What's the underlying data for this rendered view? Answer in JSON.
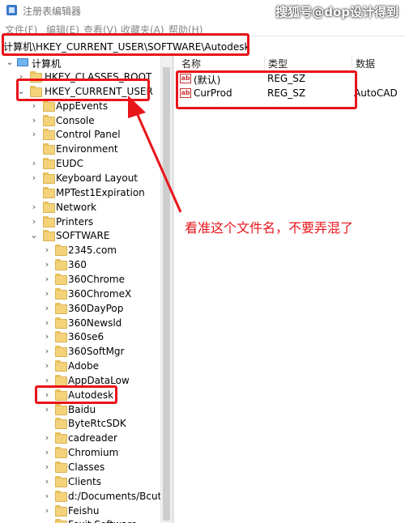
{
  "window": {
    "title": "注册表编辑器",
    "watermark": "搜狐号@dop设计得到"
  },
  "menu": [
    "文件(F)",
    "编辑(E)",
    "查看(V)",
    "收藏夹(A)",
    "帮助(H)"
  ],
  "address": "计算机\\HKEY_CURRENT_USER\\SOFTWARE\\Autodesk",
  "tree": {
    "root": "计算机",
    "items": [
      {
        "label": "HKEY_CLASSES_ROOT",
        "level": 1,
        "state": "collapsed"
      },
      {
        "label": "HKEY_CURRENT_USER",
        "level": 1,
        "state": "expanded"
      },
      {
        "label": "AppEvents",
        "level": 2,
        "state": "collapsed"
      },
      {
        "label": "Console",
        "level": 2,
        "state": "collapsed"
      },
      {
        "label": "Control Panel",
        "level": 2,
        "state": "collapsed"
      },
      {
        "label": "Environment",
        "level": 2,
        "state": "none"
      },
      {
        "label": "EUDC",
        "level": 2,
        "state": "collapsed"
      },
      {
        "label": "Keyboard Layout",
        "level": 2,
        "state": "collapsed"
      },
      {
        "label": "MPTest1Expiration",
        "level": 2,
        "state": "none"
      },
      {
        "label": "Network",
        "level": 2,
        "state": "collapsed"
      },
      {
        "label": "Printers",
        "level": 2,
        "state": "collapsed"
      },
      {
        "label": "SOFTWARE",
        "level": 2,
        "state": "expanded"
      },
      {
        "label": "2345.com",
        "level": 3,
        "state": "collapsed"
      },
      {
        "label": "360",
        "level": 3,
        "state": "collapsed"
      },
      {
        "label": "360Chrome",
        "level": 3,
        "state": "collapsed"
      },
      {
        "label": "360ChromeX",
        "level": 3,
        "state": "collapsed"
      },
      {
        "label": "360DayPop",
        "level": 3,
        "state": "collapsed"
      },
      {
        "label": "360Newsld",
        "level": 3,
        "state": "collapsed"
      },
      {
        "label": "360se6",
        "level": 3,
        "state": "collapsed"
      },
      {
        "label": "360SoftMgr",
        "level": 3,
        "state": "collapsed"
      },
      {
        "label": "Adobe",
        "level": 3,
        "state": "collapsed"
      },
      {
        "label": "AppDataLow",
        "level": 3,
        "state": "collapsed"
      },
      {
        "label": "Autodesk",
        "level": 3,
        "state": "collapsed"
      },
      {
        "label": "Baidu",
        "level": 3,
        "state": "collapsed"
      },
      {
        "label": "ByteRtcSDK",
        "level": 3,
        "state": "none"
      },
      {
        "label": "cadreader",
        "level": 3,
        "state": "collapsed"
      },
      {
        "label": "Chromium",
        "level": 3,
        "state": "collapsed"
      },
      {
        "label": "Classes",
        "level": 3,
        "state": "collapsed"
      },
      {
        "label": "Clients",
        "level": 3,
        "state": "collapsed"
      },
      {
        "label": "d:/Documents/Bcut Dr",
        "level": 3,
        "state": "collapsed"
      },
      {
        "label": "Feishu",
        "level": 3,
        "state": "collapsed"
      },
      {
        "label": "Foxit Software",
        "level": 3,
        "state": "collapsed"
      }
    ]
  },
  "list": {
    "columns": [
      "名称",
      "类型",
      "数据"
    ],
    "rows": [
      {
        "name": "(默认)",
        "type": "REG_SZ",
        "data": "",
        "icon": "ab-icon"
      },
      {
        "name": "CurProd",
        "type": "REG_SZ",
        "data": "AutoCAD",
        "icon": "ab-icon"
      }
    ]
  },
  "annotation": "看准这个文件名，不要弄混了",
  "colors": {
    "highlight": "#e8141a",
    "folder": "#f3d27a",
    "selection": "#cce8ff"
  }
}
